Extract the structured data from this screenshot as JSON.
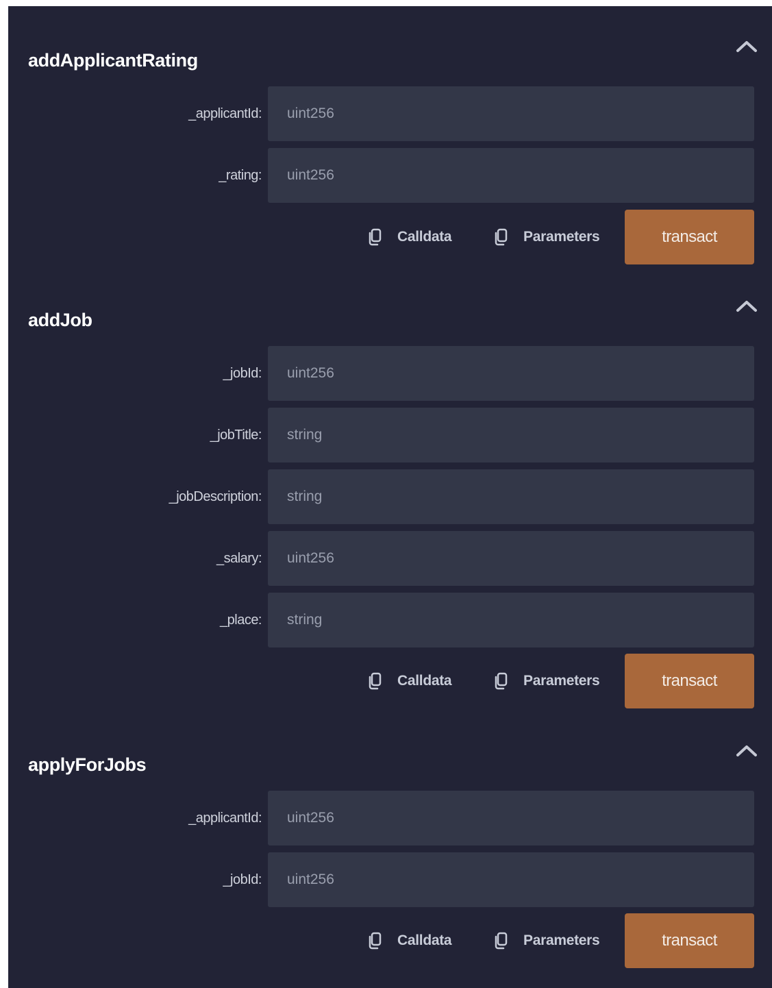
{
  "colors": {
    "panel_background": "#222336",
    "input_background": "#333748",
    "transact_button": "#a9683b",
    "title_text": "#ffffff",
    "label_text": "#cfd2dc",
    "placeholder_text": "#9a9fae"
  },
  "icons": {
    "collapse": "chevron-up-icon",
    "copy": "copy-icon"
  },
  "functions": [
    {
      "name": "addApplicantRating",
      "params": [
        {
          "label": "_applicantId:",
          "placeholder": "uint256"
        },
        {
          "label": "_rating:",
          "placeholder": "uint256"
        }
      ],
      "calldata_label": "Calldata",
      "parameters_label": "Parameters",
      "transact_label": "transact"
    },
    {
      "name": "addJob",
      "params": [
        {
          "label": "_jobId:",
          "placeholder": "uint256"
        },
        {
          "label": "_jobTitle:",
          "placeholder": "string"
        },
        {
          "label": "_jobDescription:",
          "placeholder": "string"
        },
        {
          "label": "_salary:",
          "placeholder": "uint256"
        },
        {
          "label": "_place:",
          "placeholder": "string"
        }
      ],
      "calldata_label": "Calldata",
      "parameters_label": "Parameters",
      "transact_label": "transact"
    },
    {
      "name": "applyForJobs",
      "params": [
        {
          "label": "_applicantId:",
          "placeholder": "uint256"
        },
        {
          "label": "_jobId:",
          "placeholder": "uint256"
        }
      ],
      "calldata_label": "Calldata",
      "parameters_label": "Parameters",
      "transact_label": "transact"
    }
  ]
}
